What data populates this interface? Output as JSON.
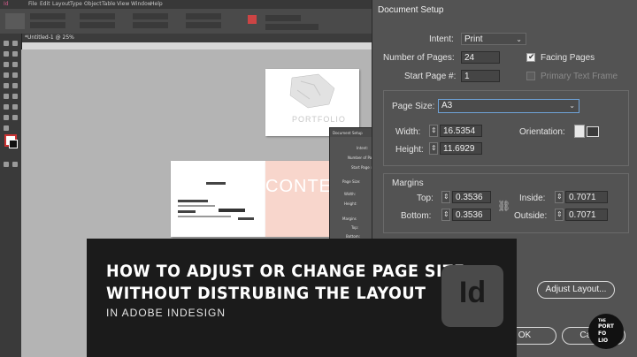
{
  "app": {
    "menu": [
      "File",
      "Edit",
      "Layout",
      "Type",
      "Object",
      "Table",
      "View",
      "Window",
      "Help"
    ],
    "doc_tab": "*Untitled-1 @ 25%"
  },
  "mini_dialog": {
    "title": "Document Setup",
    "lines": [
      "Intent:",
      "Number of Pages:",
      "Start Page #:",
      "Page Size:",
      "Width:",
      "Height:",
      "Margins",
      "Top:",
      "Bottom:"
    ]
  },
  "canvas": {
    "contents_word": "CONTE",
    "cover_word": "PORTFOLIO"
  },
  "dialog": {
    "title": "Document Setup",
    "intent_label": "Intent:",
    "intent_value": "Print",
    "pages_label": "Number of Pages:",
    "pages_value": "24",
    "facing_label": "Facing Pages",
    "facing_checked": true,
    "start_label": "Start Page #:",
    "start_value": "1",
    "primary_label": "Primary Text Frame",
    "primary_checked": false,
    "size_label": "Page Size:",
    "size_value": "A3",
    "width_label": "Width:",
    "width_value": "16.5354",
    "height_label": "Height:",
    "height_value": "11.6929",
    "orientation_label": "Orientation:",
    "margins_label": "Margins",
    "top_label": "Top:",
    "top_value": "0.3536",
    "bottom_label": "Bottom:",
    "bottom_value": "0.3536",
    "inside_label": "Inside:",
    "inside_value": "0.7071",
    "outside_label": "Outside:",
    "outside_value": "0.7071",
    "adjust_button": "Adjust Layout...",
    "ok_button": "OK",
    "cancel_button": "Cancel"
  },
  "banner": {
    "line1": "HOW TO ADJUST OR CHANGE PAGE SIZE",
    "line2": "WITHOUT DISTRUBING THE LAYOUT",
    "subtitle": "IN ADOBE INDESIGN",
    "logo_text": "Id"
  },
  "brand": {
    "lines": [
      "THE",
      "PORT",
      "FO",
      "LIO"
    ]
  },
  "colors": {
    "accent_pink": "#f8d6cc",
    "dialog_bg": "#535353",
    "banner_bg": "#1b1b1b"
  }
}
